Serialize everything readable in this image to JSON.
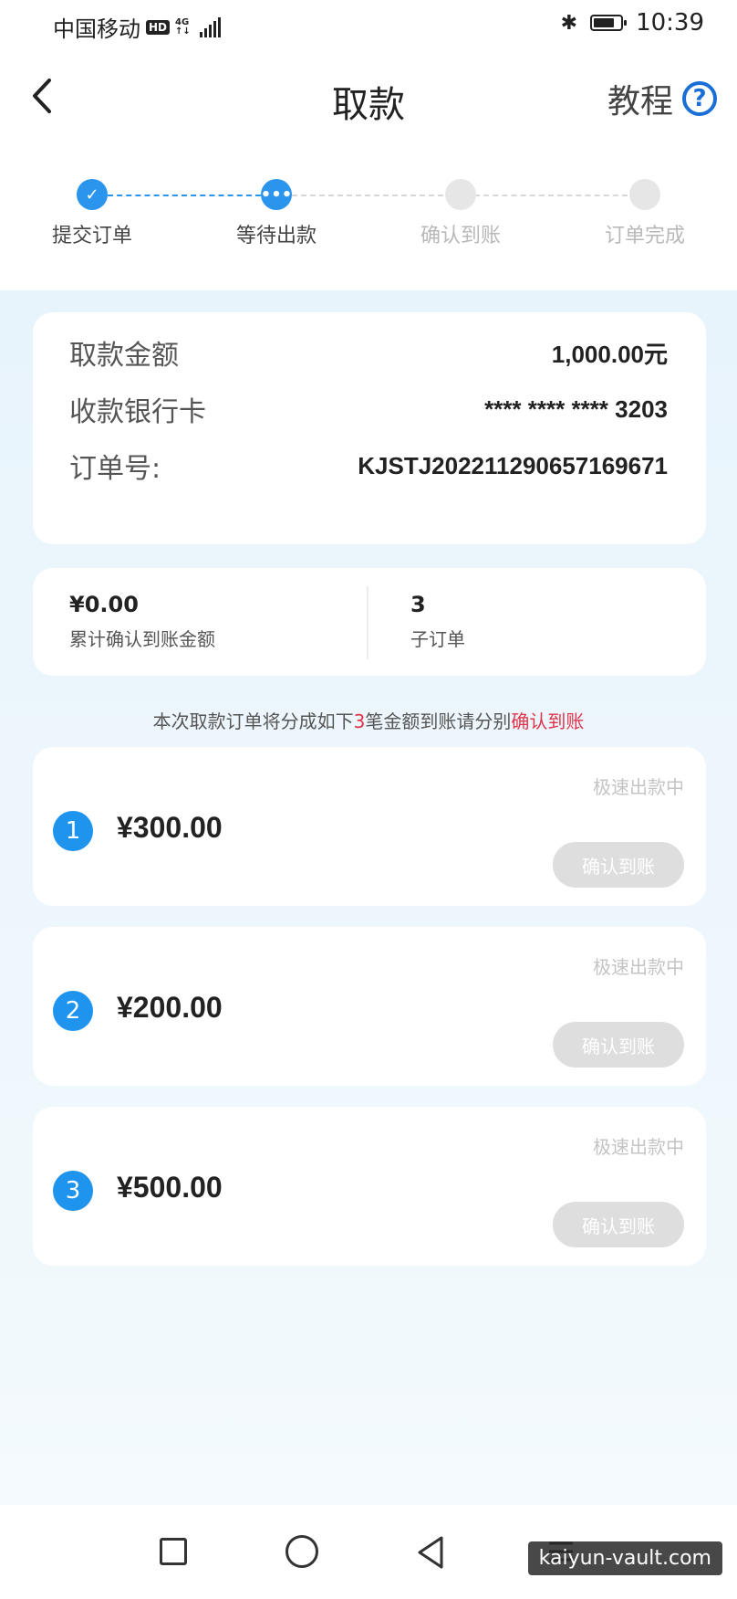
{
  "status_bar": {
    "carrier": "中国移动",
    "hd_badge": "HD",
    "network_type": "4G",
    "network_sub": "↑↓",
    "time": "10:39",
    "battery_level": 0.8
  },
  "header": {
    "title": "取款",
    "tutorial_label": "教程",
    "help_icon_text": "?"
  },
  "steps": [
    {
      "label": "提交订单",
      "state": "done",
      "icon": "✓"
    },
    {
      "label": "等待出款",
      "state": "active",
      "icon": "•••"
    },
    {
      "label": "确认到账",
      "state": "todo",
      "icon": ""
    },
    {
      "label": "订单完成",
      "state": "todo",
      "icon": ""
    }
  ],
  "order_info": {
    "amount_label": "取款金额",
    "amount_value": "1,000.00元",
    "card_label": "收款银行卡",
    "card_value": "**** **** **** 3203",
    "order_no_label": "订单号:",
    "order_no_value": "KJSTJ202211290657169671"
  },
  "stats": {
    "confirmed_value": "¥0.00",
    "confirmed_label": "累计确认到账金额",
    "sub_count_value": "3",
    "sub_count_label": "子订单"
  },
  "notice": {
    "prefix": "本次取款订单将分成如下",
    "count": "3",
    "middle": "笔金额到账请分别",
    "action": "确认到账"
  },
  "sub_orders": [
    {
      "index": "1",
      "amount": "¥300.00",
      "status": "极速出款中",
      "button": "确认到账"
    },
    {
      "index": "2",
      "amount": "¥200.00",
      "status": "极速出款中",
      "button": "确认到账"
    },
    {
      "index": "3",
      "amount": "¥500.00",
      "status": "极速出款中",
      "button": "确认到账"
    }
  ],
  "watermark": "kaiyun-vault.com",
  "colors": {
    "accent": "#2b95ee",
    "highlight_red": "#e0344a",
    "disabled_button": "#dedede"
  }
}
